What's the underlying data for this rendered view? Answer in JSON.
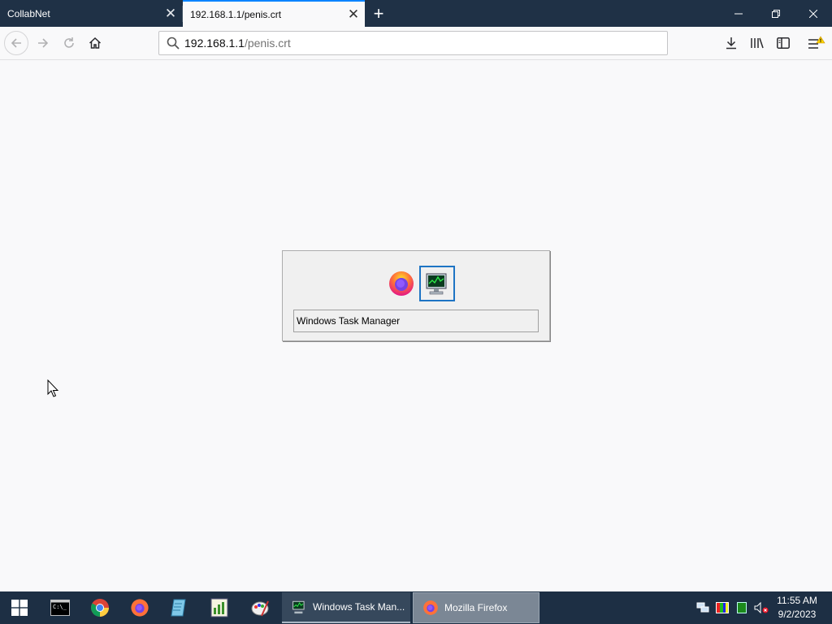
{
  "browser": {
    "tabs": [
      {
        "label": "CollabNet",
        "active": false
      },
      {
        "label": "192.168.1.1/penis.crt",
        "active": true
      }
    ],
    "url": {
      "host": "192.168.1.1",
      "path": "/penis.crt"
    },
    "colors": {
      "tabstrip": "#1f3146",
      "active_tab_accent": "#0a84ff",
      "content_bg": "#f9f9fa"
    }
  },
  "switcher": {
    "items": [
      {
        "icon": "firefox-icon",
        "selected": false
      },
      {
        "icon": "task-manager-icon",
        "selected": true
      }
    ],
    "selected_title": "Windows Task Manager"
  },
  "taskbar": {
    "pinned": [
      "start-icon",
      "terminal-icon",
      "chrome-icon",
      "firefox-icon",
      "notepad-icon",
      "spreadsheet-icon",
      "paint-icon"
    ],
    "tasks": [
      {
        "label": "Windows Task Man...",
        "icon": "task-manager-icon"
      },
      {
        "label": "Mozilla Firefox",
        "icon": "firefox-icon"
      }
    ],
    "tray": [
      "network-icon",
      "color-icon",
      "green-app-icon",
      "volume-muted-icon"
    ],
    "time": "11:55 AM",
    "date": "9/2/2023"
  }
}
